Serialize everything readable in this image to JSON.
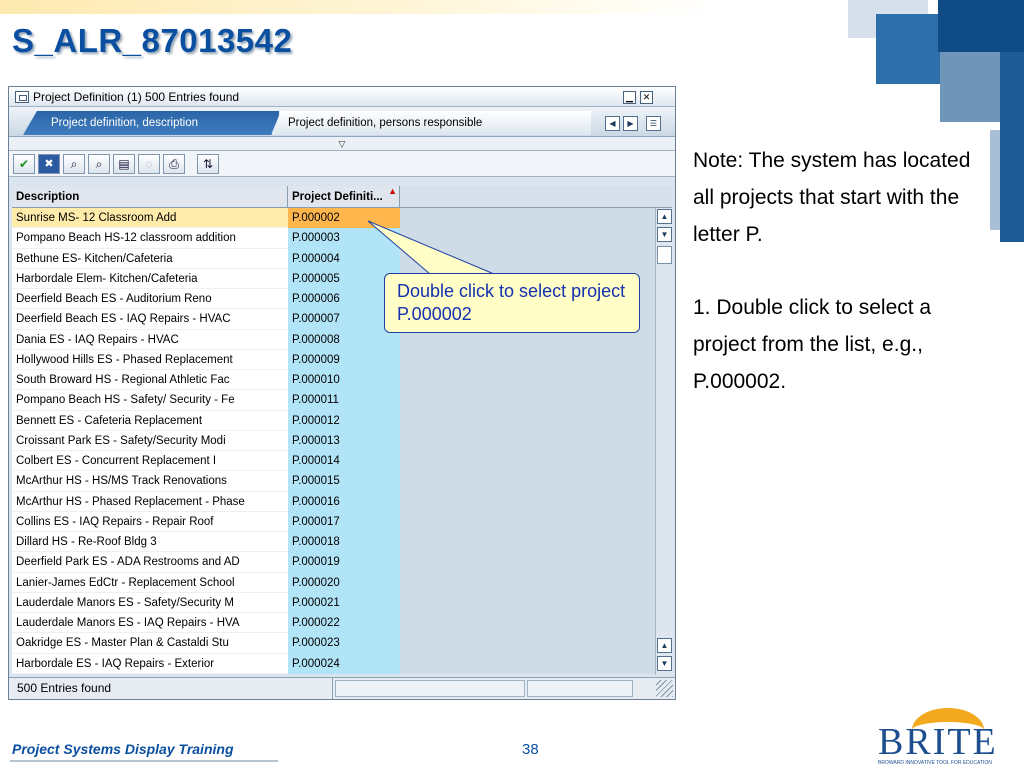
{
  "slide": {
    "title": "S_ALR_87013542",
    "footer": "Project Systems Display Training",
    "page_number": "38",
    "logo_text": "BRITE",
    "logo_tagline": "BROWARD INNOVATIVE TOOL FOR EDUCATION"
  },
  "window": {
    "title": "Project Definition (1)  500 Entries found",
    "tabs": [
      {
        "label": "Project definition, description",
        "active": true
      },
      {
        "label": "Project definition, persons responsible",
        "active": false
      }
    ],
    "collapse_glyph": "▽",
    "toolbar_icons": [
      "check-icon",
      "cancel-icon",
      "find-icon",
      "find-next-icon",
      "export-icon",
      "info-icon",
      "print-icon",
      "layout-icon",
      "sort-icon"
    ],
    "columns": {
      "description": "Description",
      "project": "Project Definiti..."
    },
    "rows": [
      {
        "desc": "Sunrise MS- 12 Classroom Add",
        "proj": "P.000002",
        "selected": true
      },
      {
        "desc": "Pompano Beach HS-12 classroom addition",
        "proj": "P.000003"
      },
      {
        "desc": "Bethune ES- Kitchen/Cafeteria",
        "proj": "P.000004"
      },
      {
        "desc": "Harbordale Elem- Kitchen/Cafeteria",
        "proj": "P.000005"
      },
      {
        "desc": "Deerfield Beach ES - Auditorium Reno",
        "proj": "P.000006"
      },
      {
        "desc": "Deerfield Beach ES - IAQ Repairs - HVAC",
        "proj": "P.000007"
      },
      {
        "desc": "Dania ES - IAQ Repairs - HVAC",
        "proj": "P.000008"
      },
      {
        "desc": "Hollywood Hills ES - Phased Replacement",
        "proj": "P.000009"
      },
      {
        "desc": "South Broward HS - Regional Athletic Fac",
        "proj": "P.000010"
      },
      {
        "desc": "Pompano Beach HS - Safety/ Security - Fe",
        "proj": "P.000011"
      },
      {
        "desc": "Bennett ES - Cafeteria Replacement",
        "proj": "P.000012"
      },
      {
        "desc": "Croissant Park ES - Safety/Security Modi",
        "proj": "P.000013"
      },
      {
        "desc": "Colbert ES - Concurrent Replacement I",
        "proj": "P.000014"
      },
      {
        "desc": "McArthur HS - HS/MS Track Renovations",
        "proj": "P.000015"
      },
      {
        "desc": "McArthur HS - Phased Replacement - Phase",
        "proj": "P.000016"
      },
      {
        "desc": "Collins ES - IAQ Repairs - Repair Roof",
        "proj": "P.000017"
      },
      {
        "desc": "Dillard HS - Re-Roof Bldg 3",
        "proj": "P.000018"
      },
      {
        "desc": "Deerfield Park ES - ADA Restrooms and AD",
        "proj": "P.000019"
      },
      {
        "desc": "Lanier-James EdCtr - Replacement School",
        "proj": "P.000020"
      },
      {
        "desc": "Lauderdale Manors ES - Safety/Security M",
        "proj": "P.000021"
      },
      {
        "desc": "Lauderdale Manors ES - IAQ Repairs - HVA",
        "proj": "P.000022"
      },
      {
        "desc": "Oakridge ES - Master Plan & Castaldi Stu",
        "proj": "P.000023"
      },
      {
        "desc": "Harbordale ES - IAQ Repairs - Exterior",
        "proj": "P.000024"
      }
    ],
    "status": "500 Entries found"
  },
  "callout": {
    "text": "Double click to select project P.000002"
  },
  "note": {
    "line1": "Note: The system has located all projects that start with the letter P.",
    "line2": "1.  Double click to select a project from the list, e.g., P.000002."
  },
  "colors": {
    "title_blue": "#0b4fa0",
    "selected_row": "#ffecab",
    "selected_key": "#ffb74d",
    "key_column": "#b2e4f7",
    "callout_bg": "#fffec6",
    "callout_text": "#1431b0"
  }
}
